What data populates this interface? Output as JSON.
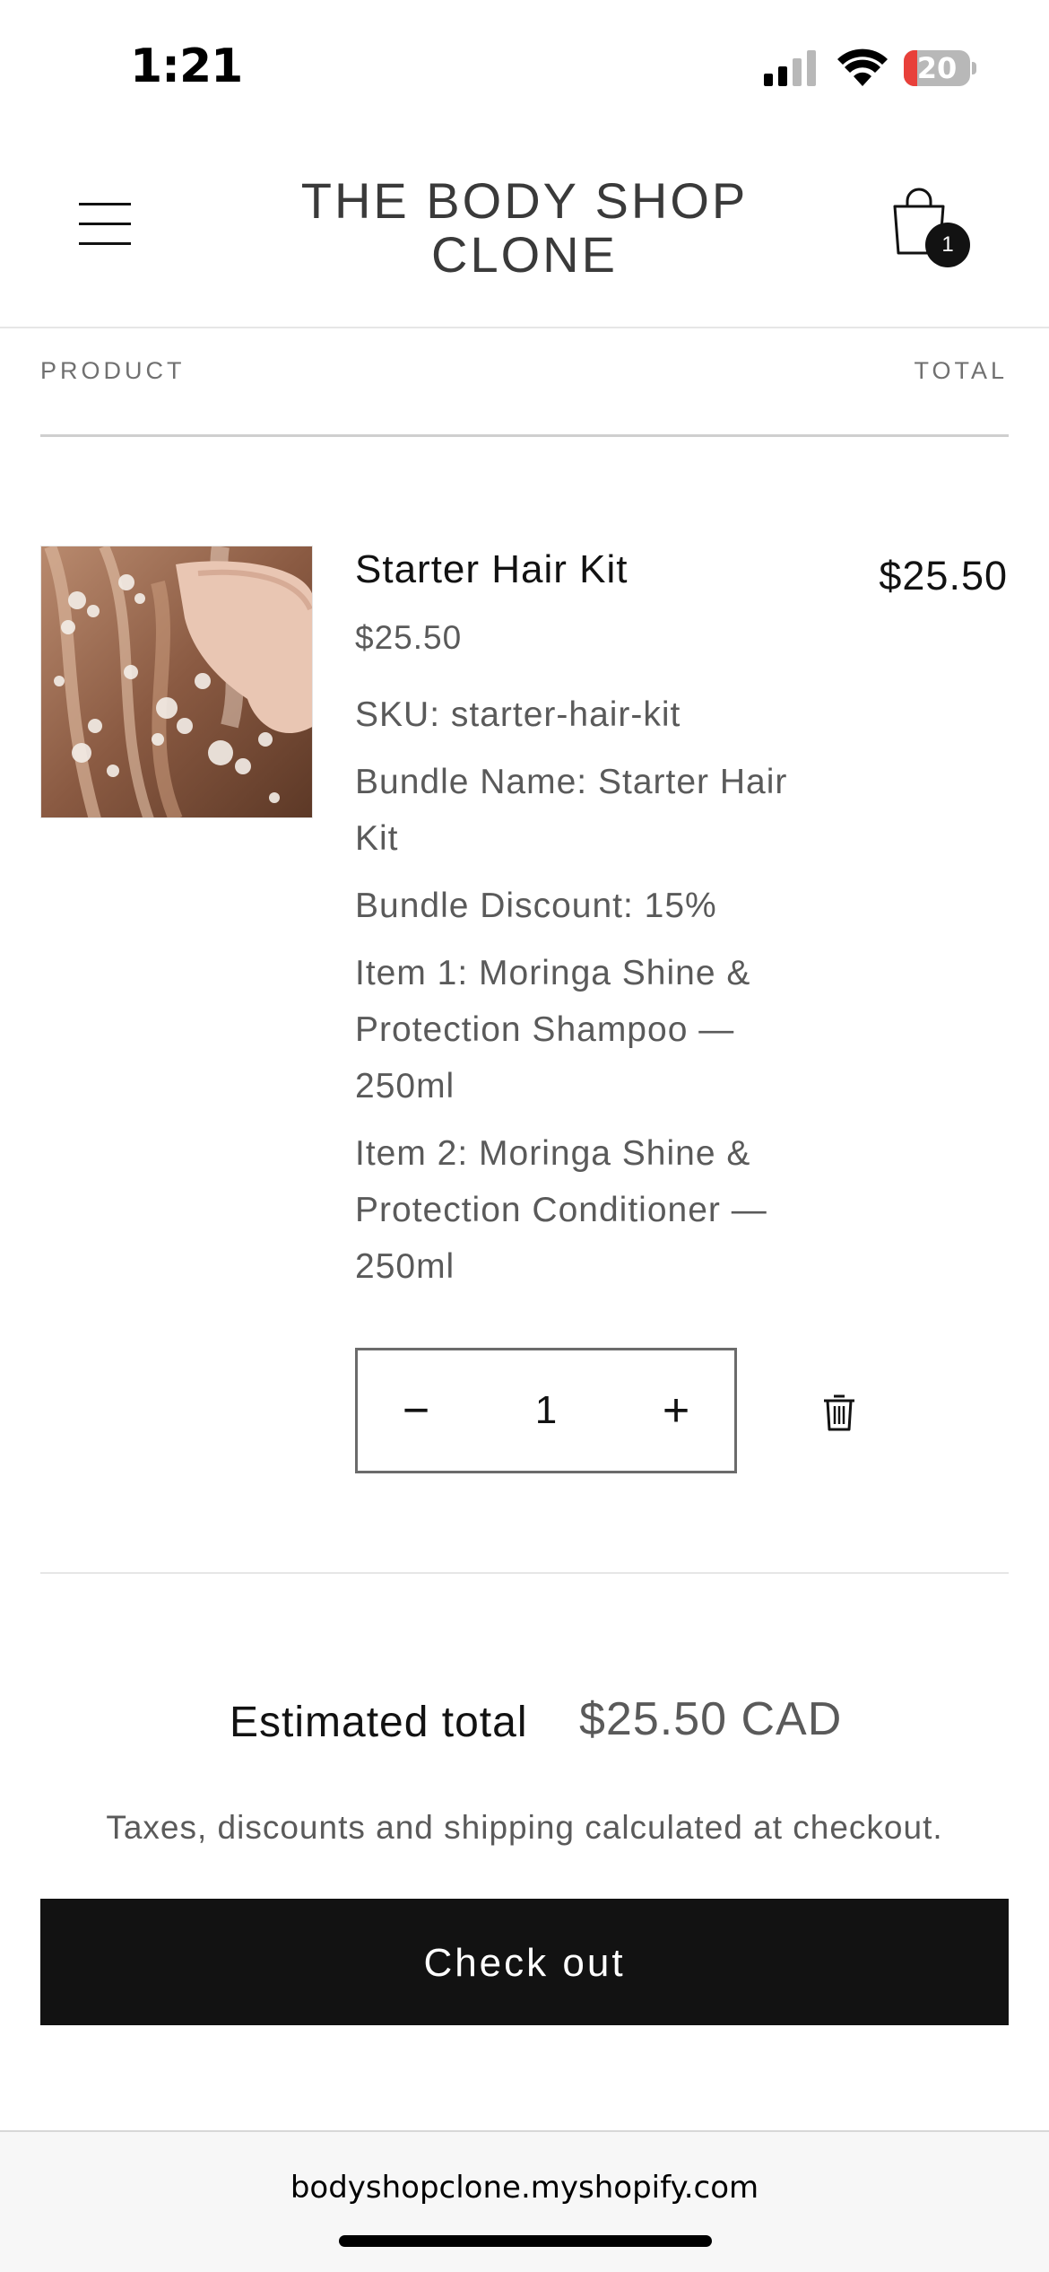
{
  "status_bar": {
    "time": "1:21",
    "battery_level": "20",
    "battery_fraction": 0.2,
    "battery_color": "#e8403a",
    "icons": [
      "signal-icon",
      "wifi-icon",
      "battery-icon"
    ]
  },
  "header": {
    "menu_icon": "hamburger-menu-icon",
    "store_title_line1": "THE BODY SHOP",
    "store_title_line2": "CLONE",
    "cart_icon": "shopping-bag-icon",
    "cart_count": "1"
  },
  "table": {
    "product_header": "PRODUCT",
    "total_header": "TOTAL"
  },
  "line_item": {
    "name": "Starter Hair Kit",
    "price": "$25.50",
    "properties": [
      "SKU: starter-hair-kit",
      "Bundle Name: Starter Hair Kit",
      "Bundle Discount: 15%",
      "Item 1: Moringa Shine & Protection Shampoo — 250ml",
      "Item 2: Moringa Shine & Protection Conditioner — 250ml"
    ],
    "line_total": "$25.50",
    "quantity": "1",
    "decrease_symbol": "−",
    "increase_symbol": "+",
    "remove_icon": "trash-icon",
    "image_alt": "hair-washing-photo"
  },
  "summary": {
    "estimated_label": "Estimated total",
    "estimated_value": "$25.50 CAD",
    "tax_note": "Taxes, discounts and shipping calculated at checkout.",
    "checkout_label": "Check out"
  },
  "browser": {
    "url": "bodyshopclone.myshopify.com"
  },
  "colors": {
    "primary": "#121212",
    "muted_text": "#5a5a5a",
    "divider": "#e6e6e6"
  }
}
